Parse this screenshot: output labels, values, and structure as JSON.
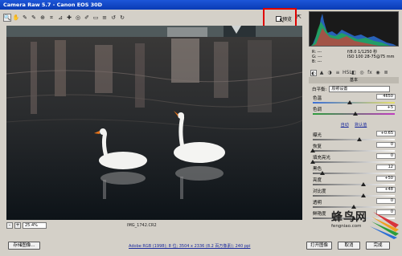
{
  "window": {
    "title": "Camera Raw 5.7  -  Canon EOS 30D"
  },
  "toolbar": {
    "tools": [
      {
        "name": "zoom-tool-icon",
        "glyph": "🔍"
      },
      {
        "name": "hand-tool-icon",
        "glyph": "✋"
      },
      {
        "name": "white-balance-tool-icon",
        "glyph": "✎"
      },
      {
        "name": "color-sampler-tool-icon",
        "glyph": "✎"
      },
      {
        "name": "targeted-adjustment-tool-icon",
        "glyph": "⊕"
      },
      {
        "name": "crop-tool-icon",
        "glyph": "⌗"
      },
      {
        "name": "straighten-tool-icon",
        "glyph": "⊿"
      },
      {
        "name": "spot-removal-tool-icon",
        "glyph": "✚"
      },
      {
        "name": "red-eye-tool-icon",
        "glyph": "◎"
      },
      {
        "name": "adjustment-brush-icon",
        "glyph": "✐"
      },
      {
        "name": "graduated-filter-icon",
        "glyph": "▭"
      },
      {
        "name": "preferences-icon",
        "glyph": "≡"
      },
      {
        "name": "rotate-ccw-icon",
        "glyph": "↺"
      },
      {
        "name": "rotate-cw-icon",
        "glyph": "↻"
      }
    ],
    "preview_label": "预览",
    "fullscreen_glyph": "⇱"
  },
  "status": {
    "zoom_minus": "-",
    "zoom_plus": "+",
    "zoom_value": "25.4%",
    "filename": "IMG_1742.CR2"
  },
  "readout": {
    "rgb": [
      "R:  ---",
      "G:  ---",
      "B:  ---"
    ],
    "cam": [
      "f/8.0   1/1250 秒",
      "ISO 100   28-75@75 mm"
    ]
  },
  "panel": {
    "tabs": [
      "◐",
      "▲",
      "◑",
      "≡",
      "HSL",
      "◧",
      "◎",
      "fx",
      "◉",
      "≣"
    ],
    "header": "基本",
    "white_balance": {
      "label": "白平衡:",
      "value": "原照设置"
    },
    "sliders": [
      {
        "label": "色温",
        "value": "4650",
        "pos": 0.45,
        "track": "temp"
      },
      {
        "label": "色调",
        "value": "+5",
        "pos": 0.52,
        "track": "tint"
      },
      {
        "label": "曝光",
        "value": "+0.65",
        "pos": 0.57,
        "track": "gray"
      },
      {
        "label": "恢复",
        "value": "0",
        "pos": 0.0,
        "track": "gray"
      },
      {
        "label": "填充亮光",
        "value": "0",
        "pos": 0.0,
        "track": "gray"
      },
      {
        "label": "黑色",
        "value": "12",
        "pos": 0.12,
        "track": "gray"
      },
      {
        "label": "亮度",
        "value": "+50",
        "pos": 0.62,
        "track": "gray"
      },
      {
        "label": "对比度",
        "value": "+48",
        "pos": 0.62,
        "track": "gray"
      },
      {
        "label": "透明",
        "value": "0",
        "pos": 0.5,
        "track": "gray"
      },
      {
        "label": "鲜艳度",
        "value": "0",
        "pos": 0.5,
        "track": "gray"
      }
    ],
    "auto_links": [
      "自动",
      "默认值"
    ]
  },
  "bottom": {
    "save_label": "存储图像...",
    "workflow_label": "Adobe RGB (1998); 8 位; 3504 x 2336 (8.2 百万像素); 240 ppi",
    "open_label": "打开图像",
    "cancel_label": "取消",
    "done_label": "完成"
  },
  "watermark": {
    "title": "蜂鸟网",
    "url": "fengniao.com"
  },
  "colors": {
    "title_bar": "#0a3bb4",
    "preview_highlight": "#e00000",
    "link": "#1b2a9c"
  }
}
